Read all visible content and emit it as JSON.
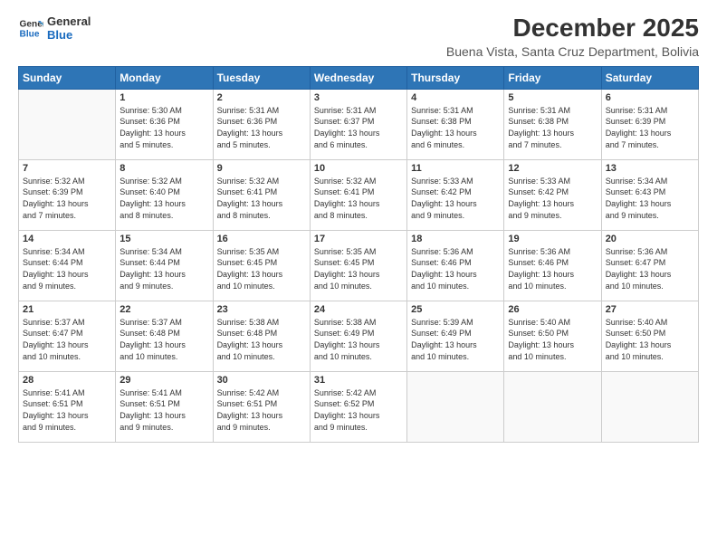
{
  "logo": {
    "line1": "General",
    "line2": "Blue"
  },
  "title": "December 2025",
  "subtitle": "Buena Vista, Santa Cruz Department, Bolivia",
  "weekdays": [
    "Sunday",
    "Monday",
    "Tuesday",
    "Wednesday",
    "Thursday",
    "Friday",
    "Saturday"
  ],
  "weeks": [
    [
      {
        "day": "",
        "sunrise": "",
        "sunset": "",
        "daylight": ""
      },
      {
        "day": "1",
        "sunrise": "Sunrise: 5:30 AM",
        "sunset": "Sunset: 6:36 PM",
        "daylight": "Daylight: 13 hours and 5 minutes."
      },
      {
        "day": "2",
        "sunrise": "Sunrise: 5:31 AM",
        "sunset": "Sunset: 6:36 PM",
        "daylight": "Daylight: 13 hours and 5 minutes."
      },
      {
        "day": "3",
        "sunrise": "Sunrise: 5:31 AM",
        "sunset": "Sunset: 6:37 PM",
        "daylight": "Daylight: 13 hours and 6 minutes."
      },
      {
        "day": "4",
        "sunrise": "Sunrise: 5:31 AM",
        "sunset": "Sunset: 6:38 PM",
        "daylight": "Daylight: 13 hours and 6 minutes."
      },
      {
        "day": "5",
        "sunrise": "Sunrise: 5:31 AM",
        "sunset": "Sunset: 6:38 PM",
        "daylight": "Daylight: 13 hours and 7 minutes."
      },
      {
        "day": "6",
        "sunrise": "Sunrise: 5:31 AM",
        "sunset": "Sunset: 6:39 PM",
        "daylight": "Daylight: 13 hours and 7 minutes."
      }
    ],
    [
      {
        "day": "7",
        "sunrise": "Sunrise: 5:32 AM",
        "sunset": "Sunset: 6:39 PM",
        "daylight": "Daylight: 13 hours and 7 minutes."
      },
      {
        "day": "8",
        "sunrise": "Sunrise: 5:32 AM",
        "sunset": "Sunset: 6:40 PM",
        "daylight": "Daylight: 13 hours and 8 minutes."
      },
      {
        "day": "9",
        "sunrise": "Sunrise: 5:32 AM",
        "sunset": "Sunset: 6:41 PM",
        "daylight": "Daylight: 13 hours and 8 minutes."
      },
      {
        "day": "10",
        "sunrise": "Sunrise: 5:32 AM",
        "sunset": "Sunset: 6:41 PM",
        "daylight": "Daylight: 13 hours and 8 minutes."
      },
      {
        "day": "11",
        "sunrise": "Sunrise: 5:33 AM",
        "sunset": "Sunset: 6:42 PM",
        "daylight": "Daylight: 13 hours and 9 minutes."
      },
      {
        "day": "12",
        "sunrise": "Sunrise: 5:33 AM",
        "sunset": "Sunset: 6:42 PM",
        "daylight": "Daylight: 13 hours and 9 minutes."
      },
      {
        "day": "13",
        "sunrise": "Sunrise: 5:34 AM",
        "sunset": "Sunset: 6:43 PM",
        "daylight": "Daylight: 13 hours and 9 minutes."
      }
    ],
    [
      {
        "day": "14",
        "sunrise": "Sunrise: 5:34 AM",
        "sunset": "Sunset: 6:44 PM",
        "daylight": "Daylight: 13 hours and 9 minutes."
      },
      {
        "day": "15",
        "sunrise": "Sunrise: 5:34 AM",
        "sunset": "Sunset: 6:44 PM",
        "daylight": "Daylight: 13 hours and 9 minutes."
      },
      {
        "day": "16",
        "sunrise": "Sunrise: 5:35 AM",
        "sunset": "Sunset: 6:45 PM",
        "daylight": "Daylight: 13 hours and 10 minutes."
      },
      {
        "day": "17",
        "sunrise": "Sunrise: 5:35 AM",
        "sunset": "Sunset: 6:45 PM",
        "daylight": "Daylight: 13 hours and 10 minutes."
      },
      {
        "day": "18",
        "sunrise": "Sunrise: 5:36 AM",
        "sunset": "Sunset: 6:46 PM",
        "daylight": "Daylight: 13 hours and 10 minutes."
      },
      {
        "day": "19",
        "sunrise": "Sunrise: 5:36 AM",
        "sunset": "Sunset: 6:46 PM",
        "daylight": "Daylight: 13 hours and 10 minutes."
      },
      {
        "day": "20",
        "sunrise": "Sunrise: 5:36 AM",
        "sunset": "Sunset: 6:47 PM",
        "daylight": "Daylight: 13 hours and 10 minutes."
      }
    ],
    [
      {
        "day": "21",
        "sunrise": "Sunrise: 5:37 AM",
        "sunset": "Sunset: 6:47 PM",
        "daylight": "Daylight: 13 hours and 10 minutes."
      },
      {
        "day": "22",
        "sunrise": "Sunrise: 5:37 AM",
        "sunset": "Sunset: 6:48 PM",
        "daylight": "Daylight: 13 hours and 10 minutes."
      },
      {
        "day": "23",
        "sunrise": "Sunrise: 5:38 AM",
        "sunset": "Sunset: 6:48 PM",
        "daylight": "Daylight: 13 hours and 10 minutes."
      },
      {
        "day": "24",
        "sunrise": "Sunrise: 5:38 AM",
        "sunset": "Sunset: 6:49 PM",
        "daylight": "Daylight: 13 hours and 10 minutes."
      },
      {
        "day": "25",
        "sunrise": "Sunrise: 5:39 AM",
        "sunset": "Sunset: 6:49 PM",
        "daylight": "Daylight: 13 hours and 10 minutes."
      },
      {
        "day": "26",
        "sunrise": "Sunrise: 5:40 AM",
        "sunset": "Sunset: 6:50 PM",
        "daylight": "Daylight: 13 hours and 10 minutes."
      },
      {
        "day": "27",
        "sunrise": "Sunrise: 5:40 AM",
        "sunset": "Sunset: 6:50 PM",
        "daylight": "Daylight: 13 hours and 10 minutes."
      }
    ],
    [
      {
        "day": "28",
        "sunrise": "Sunrise: 5:41 AM",
        "sunset": "Sunset: 6:51 PM",
        "daylight": "Daylight: 13 hours and 9 minutes."
      },
      {
        "day": "29",
        "sunrise": "Sunrise: 5:41 AM",
        "sunset": "Sunset: 6:51 PM",
        "daylight": "Daylight: 13 hours and 9 minutes."
      },
      {
        "day": "30",
        "sunrise": "Sunrise: 5:42 AM",
        "sunset": "Sunset: 6:51 PM",
        "daylight": "Daylight: 13 hours and 9 minutes."
      },
      {
        "day": "31",
        "sunrise": "Sunrise: 5:42 AM",
        "sunset": "Sunset: 6:52 PM",
        "daylight": "Daylight: 13 hours and 9 minutes."
      },
      {
        "day": "",
        "sunrise": "",
        "sunset": "",
        "daylight": ""
      },
      {
        "day": "",
        "sunrise": "",
        "sunset": "",
        "daylight": ""
      },
      {
        "day": "",
        "sunrise": "",
        "sunset": "",
        "daylight": ""
      }
    ]
  ]
}
